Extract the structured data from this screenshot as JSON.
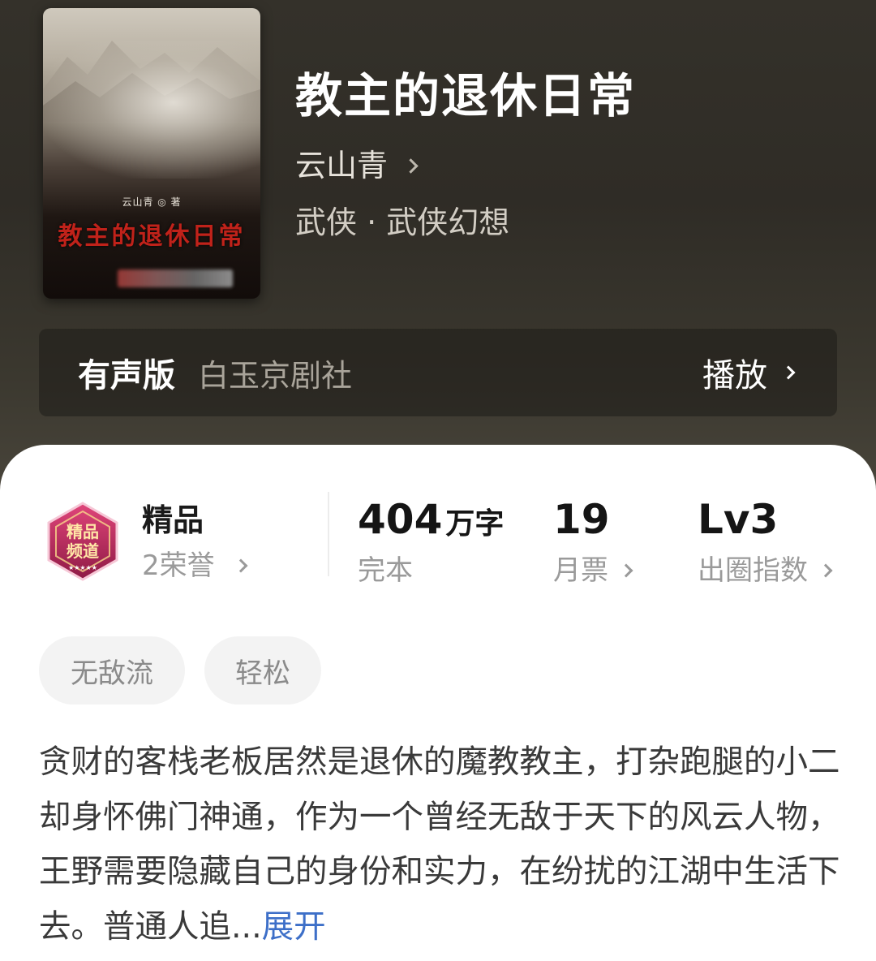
{
  "book": {
    "cover": {
      "author_small": "云山青 ◎ 著",
      "title": "教主的退休日常"
    },
    "title": "教主的退休日常",
    "author": "云山青",
    "genre": "武侠 · 武侠幻想"
  },
  "audio": {
    "label": "有声版",
    "studio": "白玉京剧社",
    "play_label": "播放"
  },
  "quality": {
    "badge_icon": "premium-badge-icon",
    "name": "精品",
    "honors": "2荣誉"
  },
  "stats": {
    "words_value": "404",
    "words_unit": "万字",
    "words_label": "完本",
    "tickets_value": "19",
    "tickets_label": "月票",
    "level_value": "Lv3",
    "level_label": "出圈指数"
  },
  "tags": [
    "无敌流",
    "轻松"
  ],
  "synopsis": {
    "text": "贪财的客栈老板居然是退休的魔教教主，打杂跑腿的小二却身怀佛门神通，作为一个曾经无敌于天下的风云人物，王野需要隐藏自己的身份和实力，在纷扰的江湖中生活下去。普通人追...",
    "expand_label": "展开"
  },
  "colors": {
    "header_bg": "#34312a",
    "link": "#3d6fc8",
    "badge": "#b8255a"
  }
}
